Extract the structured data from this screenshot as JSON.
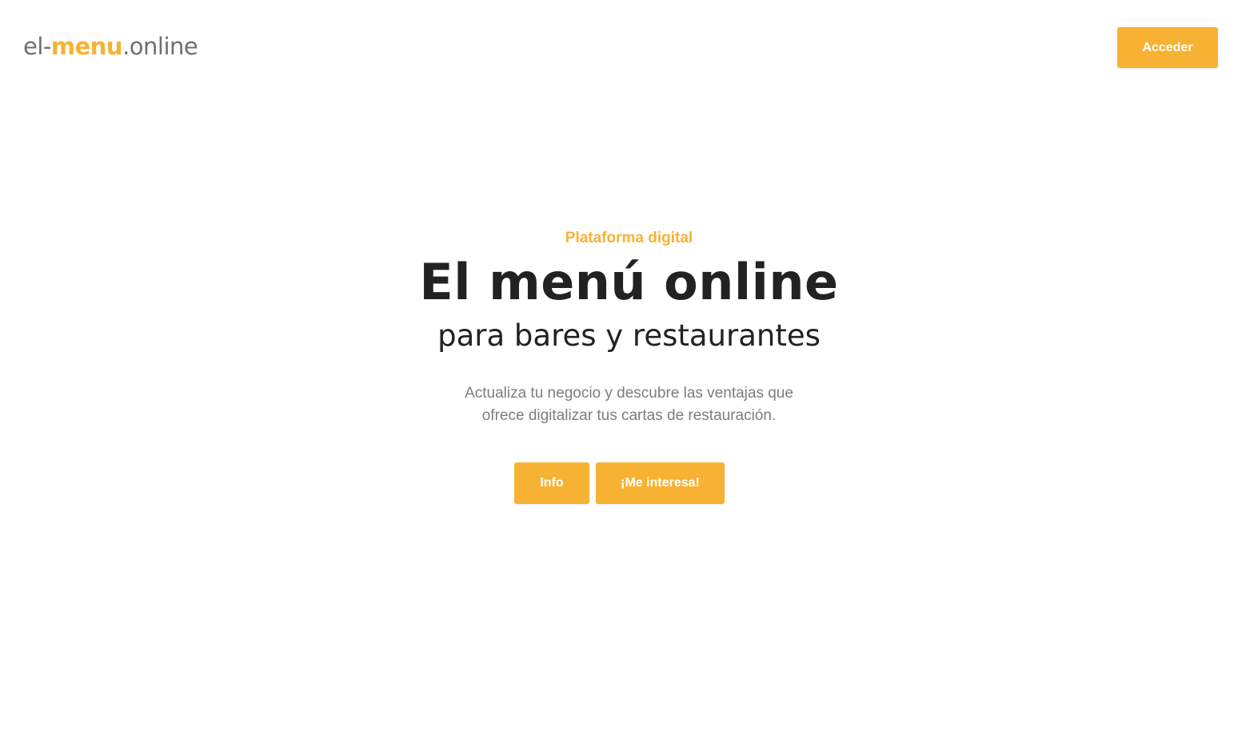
{
  "header": {
    "logo": {
      "prefix": "el-",
      "accent": "menu",
      "suffix": ".online"
    },
    "login_label": "Acceder"
  },
  "hero": {
    "eyebrow": "Plataforma digital",
    "title": "El menú online",
    "subtitle": "para bares y restaurantes",
    "description_line1": "Actualiza tu negocio y descubre las ventajas que",
    "description_line2": "ofrece digitalizar tus cartas de restauración.",
    "buttons": {
      "info_label": "Info",
      "interest_label": "¡Me interesa!"
    }
  },
  "colors": {
    "accent": "#f7b233",
    "text_dark": "#222222",
    "text_muted": "#7d7d7d",
    "logo_gray": "#6f6f6f",
    "background": "#ffffff"
  }
}
